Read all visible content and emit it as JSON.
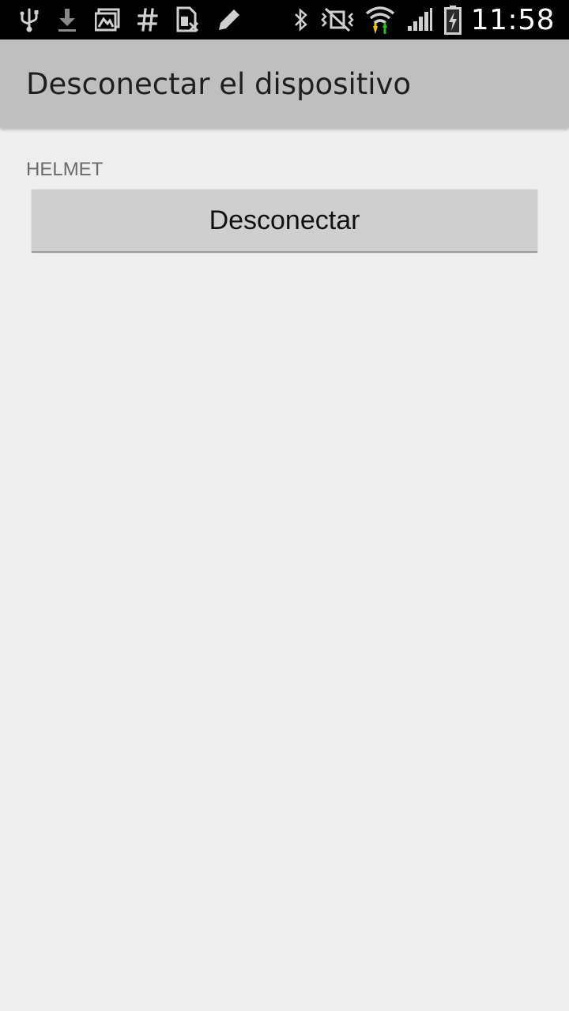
{
  "status_bar": {
    "time": "11:58",
    "left_icons": [
      "usb-icon",
      "download-icon",
      "gallery-icon",
      "hashtag-icon",
      "sim-card-icon",
      "pencil-icon"
    ],
    "right_icons": [
      "bluetooth-icon",
      "vibrate-mute-icon",
      "wifi-icon",
      "signal-icon",
      "battery-charging-icon"
    ]
  },
  "action_bar": {
    "title": "Desconectar el dispositivo"
  },
  "content": {
    "device_name": "HELMET",
    "disconnect_label": "Desconectar"
  },
  "colors": {
    "status_bar_bg": "#000000",
    "action_bar_bg": "#bfbfbf",
    "page_bg": "#eeeeee",
    "button_bg": "#cfcfcf",
    "wifi_up_arrow": "#e6c61a",
    "wifi_down_arrow": "#2fb82f"
  }
}
